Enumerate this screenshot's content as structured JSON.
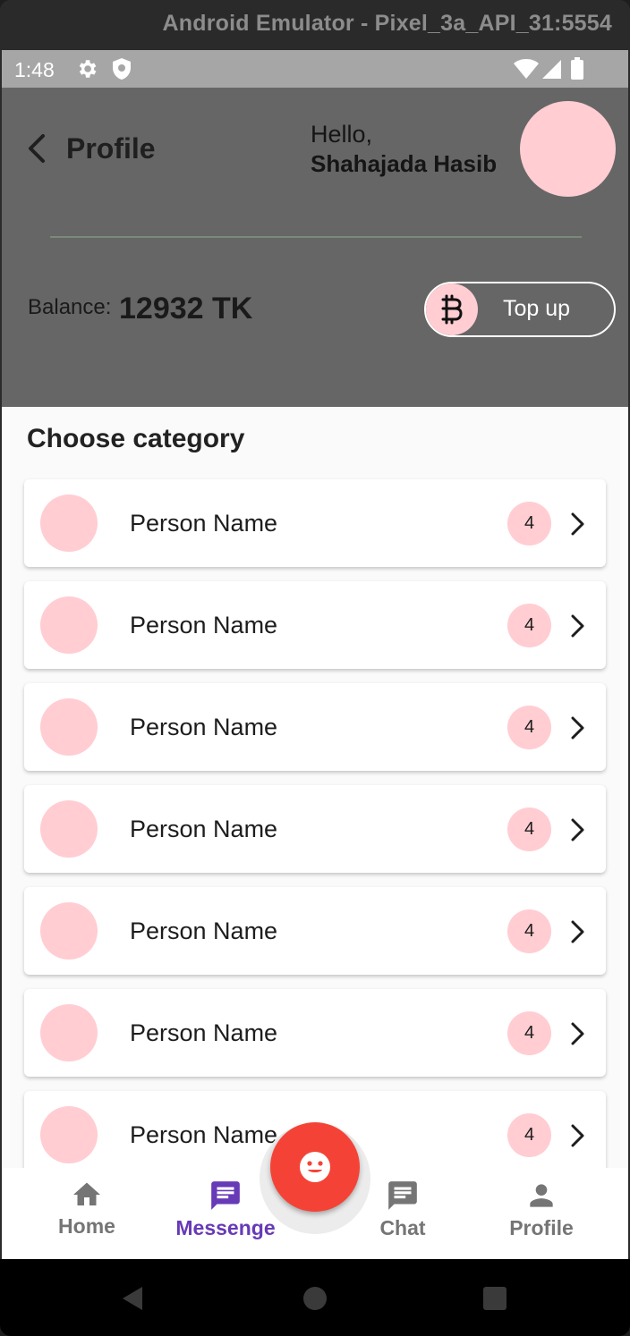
{
  "window": {
    "title": "Android Emulator - Pixel_3a_API_31:5554"
  },
  "status_bar": {
    "time": "1:48",
    "icons": [
      "gear-icon",
      "shield-icon",
      "wifi-icon",
      "signal-icon",
      "battery-icon"
    ]
  },
  "header": {
    "title": "Profile",
    "greeting": "Hello,",
    "user_name": "Shahajada Hasib",
    "balance_label": "Balance:",
    "balance_value": "12932 TK",
    "topup_label": "Top up"
  },
  "section": {
    "title": "Choose category"
  },
  "list": {
    "items": [
      {
        "name": "Person Name",
        "count": "4"
      },
      {
        "name": "Person Name",
        "count": "4"
      },
      {
        "name": "Person Name",
        "count": "4"
      },
      {
        "name": "Person Name",
        "count": "4"
      },
      {
        "name": "Person Name",
        "count": "4"
      },
      {
        "name": "Person Name",
        "count": "4"
      },
      {
        "name": "Person Name",
        "count": "4"
      }
    ]
  },
  "bottom_nav": {
    "items": [
      {
        "label": "Home",
        "icon": "home-icon",
        "active": false
      },
      {
        "label": "Messenge",
        "icon": "message-icon",
        "active": true
      },
      {
        "label": "Chat",
        "icon": "chat-icon",
        "active": false
      },
      {
        "label": "Profile",
        "icon": "person-icon",
        "active": false
      }
    ],
    "fab_icon": "smiley-icon"
  },
  "colors": {
    "header_bg": "#666666",
    "accent_pink": "#ffcdd2",
    "fab_red": "#f44336",
    "nav_active": "#673ab7",
    "nav_inactive": "#757575"
  }
}
